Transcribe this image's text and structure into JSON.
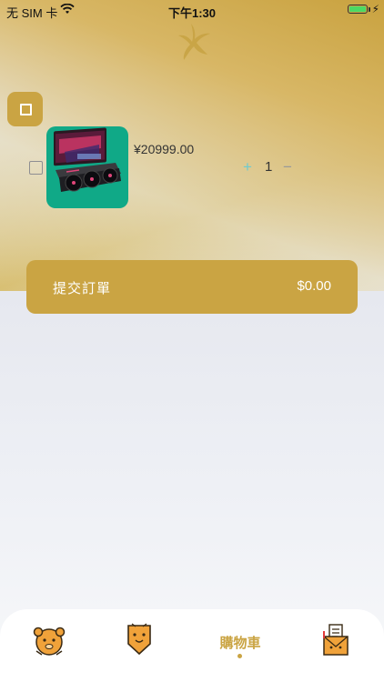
{
  "status_bar": {
    "carrier": "无 SIM 卡",
    "time": "下午1:30",
    "battery_level": 1.0
  },
  "cart": {
    "items": [
      {
        "price": "¥20999.00",
        "quantity": "1",
        "plus_symbol": "+",
        "minus_symbol": "−",
        "thumbnail_icon": "graphics-card-product-image"
      }
    ]
  },
  "submit": {
    "label": "提交訂單",
    "total": "$0.00"
  },
  "tab_bar": {
    "active_tab_label": "購物車",
    "tabs": [
      {
        "icon": "mascot-home-icon"
      },
      {
        "icon": "mascot-badge-icon"
      },
      {
        "label": "購物車"
      },
      {
        "icon": "mascot-orders-icon"
      }
    ]
  },
  "colors": {
    "accent": "#caa443",
    "thumb_bg": "#10a987",
    "plus": "#6ecbcf"
  }
}
